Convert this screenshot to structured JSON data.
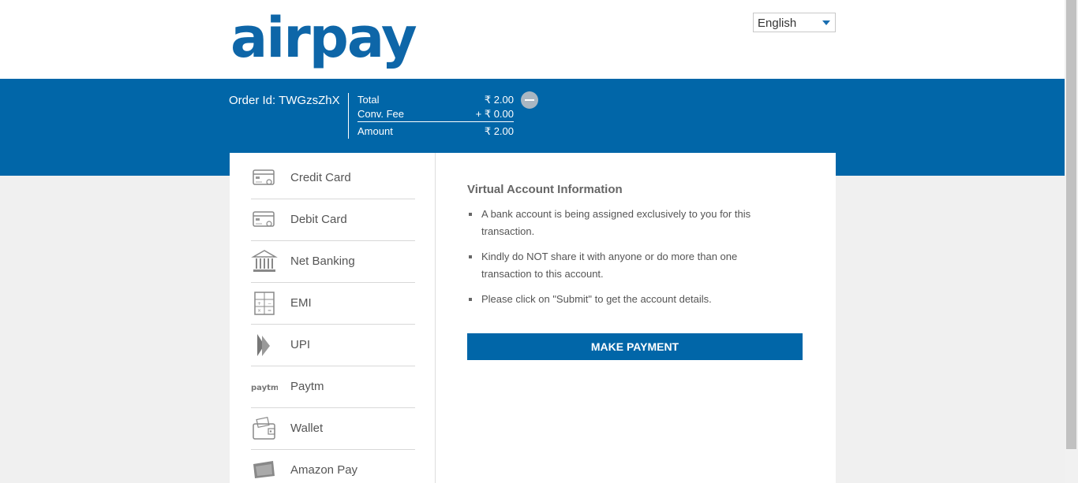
{
  "brand": {
    "logo_text": "airpay",
    "color": "#0166a8"
  },
  "language": {
    "selected": "English"
  },
  "order": {
    "label": "Order Id: TWGzsZhX",
    "total_label": "Total",
    "total_value": "₹ 2.00",
    "fee_label": "Conv. Fee",
    "fee_value": "+ ₹ 0.00",
    "amount_label": "Amount",
    "amount_value": "₹ 2.00"
  },
  "payment_methods": [
    {
      "label": "Credit Card",
      "icon": "credit-card-icon"
    },
    {
      "label": "Debit Card",
      "icon": "debit-card-icon"
    },
    {
      "label": "Net Banking",
      "icon": "bank-icon"
    },
    {
      "label": "EMI",
      "icon": "calculator-icon"
    },
    {
      "label": "UPI",
      "icon": "upi-icon"
    },
    {
      "label": "Paytm",
      "icon": "paytm-icon",
      "icon_text": "paytm"
    },
    {
      "label": "Wallet",
      "icon": "wallet-icon"
    },
    {
      "label": "Amazon Pay",
      "icon": "amazon-pay-icon"
    }
  ],
  "virtual_account": {
    "title": "Virtual Account Information",
    "bullets": [
      "A bank account is being assigned exclusively to you for this transaction.",
      "Kindly do NOT share it with anyone or do more than one transaction to this account.",
      "Please click on \"Submit\" to get the account details."
    ],
    "button_label": "MAKE PAYMENT"
  }
}
